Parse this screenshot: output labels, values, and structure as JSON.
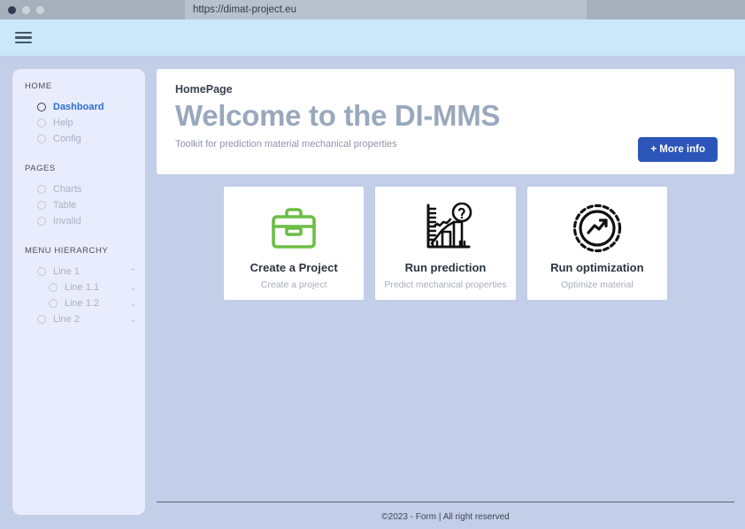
{
  "browser": {
    "url": "https://dimat-project.eu",
    "dots": [
      "window-close-dot",
      "window-minimize-dot",
      "window-maximize-dot"
    ]
  },
  "topbar": {
    "menu_icon": "hamburger-menu-icon"
  },
  "sidebar": {
    "groups": [
      {
        "title": "HOME",
        "items": [
          {
            "label": "Dashboard",
            "active": true,
            "chevron": ""
          },
          {
            "label": "Help",
            "active": false,
            "chevron": ""
          },
          {
            "label": "Config",
            "active": false,
            "chevron": ""
          }
        ]
      },
      {
        "title": "PAGES",
        "items": [
          {
            "label": "Charts",
            "active": false,
            "chevron": ""
          },
          {
            "label": "Table",
            "active": false,
            "chevron": ""
          },
          {
            "label": "Invalid",
            "active": false,
            "chevron": ""
          }
        ]
      },
      {
        "title": "MENU HIERARCHY",
        "items": [
          {
            "label": "Line 1",
            "active": false,
            "chevron": "⌃",
            "indent": false
          },
          {
            "label": "Line 1.1",
            "active": false,
            "chevron": "⌄",
            "indent": true
          },
          {
            "label": "Line 1.2",
            "active": false,
            "chevron": "⌄",
            "indent": true
          },
          {
            "label": "Line 2",
            "active": false,
            "chevron": "⌄",
            "indent": false
          }
        ]
      }
    ]
  },
  "hero": {
    "eyebrow": "HomePage",
    "title": "Welcome to the DI-MMS",
    "subtitle": "Toolkit for prediction material mechanical properties",
    "button_label": "+ More info",
    "button_color": "#2b55b8"
  },
  "cards": [
    {
      "icon": "briefcase-icon",
      "icon_color": "#6cbe45",
      "title": "Create a Project",
      "subtitle": "Create a project"
    },
    {
      "icon": "chart-question-icon",
      "icon_color": "#111111",
      "title": "Run prediction",
      "subtitle": "Predict mechanical properties"
    },
    {
      "icon": "gear-trend-icon",
      "icon_color": "#111111",
      "title": "Run optimization",
      "subtitle": "Optimize material"
    }
  ],
  "footer": {
    "text": "©2023 - Form |  All right reserved"
  },
  "colors": {
    "page_background": "#c3cee8",
    "sidebar_background": "#e8ecfd",
    "topbar_background": "#cae8fa",
    "accent_blue": "#2b55b8",
    "active_link": "#2f6fd0"
  }
}
